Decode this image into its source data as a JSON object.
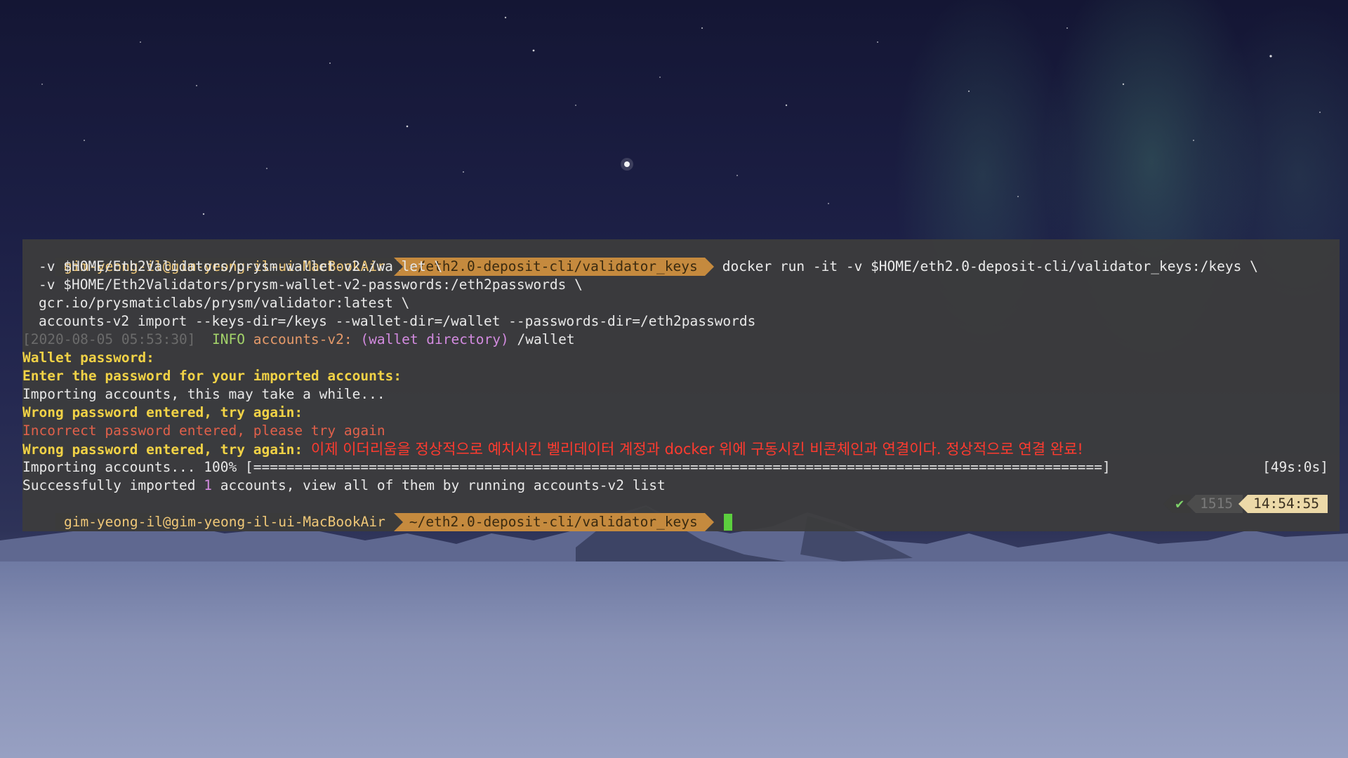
{
  "terminal": {
    "line1": {
      "user": "gim-yeong-il@gim-yeong-il-ui-MacBookAir",
      "dir": "~/eth2.0-deposit-cli/validator_keys",
      "command": "docker run -it -v $HOME/eth2.0-deposit-cli/validator_keys:/keys \\"
    },
    "line2": "-v $HOME/Eth2Validators/prysm-wallet-v2:/wallet \\",
    "line3": "-v $HOME/Eth2Validators/prysm-wallet-v2-passwords:/eth2passwords \\",
    "line4": "gcr.io/prysmaticlabs/prysm/validator:latest \\",
    "line5": "accounts-v2 import --keys-dir=/keys --wallet-dir=/wallet --passwords-dir=/eth2passwords",
    "log": {
      "timestamp": "[2020-08-05 05:53:30]",
      "level": "INFO",
      "module": "accounts-v2:",
      "field": "(wallet directory)",
      "value": "/wallet"
    },
    "wallet_password": "Wallet password:",
    "enter_password": "Enter the password for your imported accounts:",
    "importing": "Importing accounts, this may take a while...",
    "wrong1": "Wrong password entered, try again:",
    "incorrect": "Incorrect password entered, please try again",
    "wrong2": "Wrong password entered, try again:",
    "annotation": "이제 이더리움을 정상적으로 예치시킨 벨리데이터 계정과 docker 위에 구동시킨 비콘체인과 연결이다. 정상적으로 연결 완료!",
    "progress": {
      "label": "Importing accounts... 100% [",
      "bar": "=======================================================================================================",
      "end": "]",
      "time": "[49s:0s]",
      "percent": 100
    },
    "success": {
      "prefix": "Successfully imported ",
      "count": "1",
      "suffix": " accounts, view all of them by running accounts-v2 list"
    },
    "prompt2": {
      "user": "gim-yeong-il@gim-yeong-il-ui-MacBookAir",
      "dir": "~/eth2.0-deposit-cli/validator_keys"
    },
    "rprompt": {
      "status": "✔",
      "history": "1515",
      "time": "14:54:55"
    }
  },
  "colors": {
    "prompt_user_bg": "#3b3b3b",
    "prompt_dir_bg": "#c58a3e",
    "cursor": "#5ccf3e",
    "warning": "#f1d246",
    "error": "#e0604a",
    "annotation": "#ff3b2f"
  }
}
